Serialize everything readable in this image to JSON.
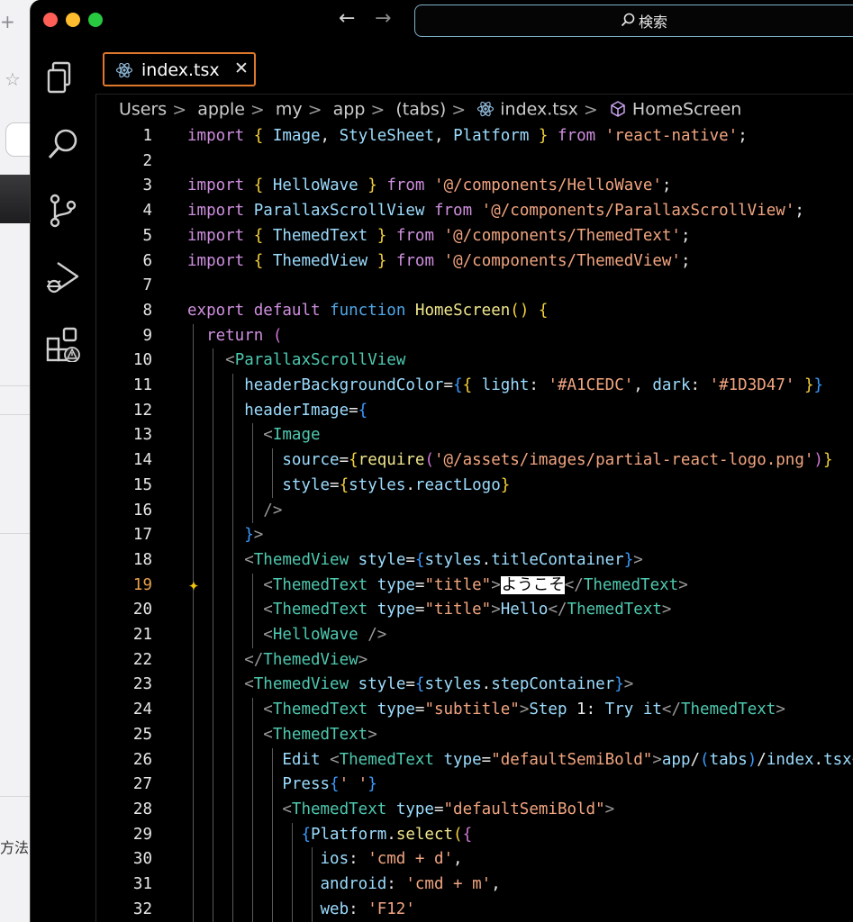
{
  "titlebar": {
    "search_label": "検索"
  },
  "activity_bar": {
    "items": [
      "explorer-icon",
      "search-icon",
      "source-control-icon",
      "run-debug-icon",
      "extensions-icon"
    ]
  },
  "tab": {
    "label": "index.tsx",
    "icon": "react-icon",
    "close": "✕"
  },
  "breadcrumb": [
    "Users",
    "apple",
    "my",
    "app",
    "(tabs)",
    "index.tsx",
    "HomeScreen"
  ],
  "background_window": {
    "text": "方法で"
  },
  "editor": {
    "current_line": 19,
    "lines": [
      "import { Image, StyleSheet, Platform } from 'react-native';",
      "",
      "import { HelloWave } from '@/components/HelloWave';",
      "import ParallaxScrollView from '@/components/ParallaxScrollView';",
      "import { ThemedText } from '@/components/ThemedText';",
      "import { ThemedView } from '@/components/ThemedView';",
      "",
      "export default function HomeScreen() {",
      "  return (",
      "    <ParallaxScrollView",
      "      headerBackgroundColor={{ light: '#A1CEDC', dark: '#1D3D47' }}",
      "      headerImage={",
      "        <Image",
      "          source={require('@/assets/images/partial-react-logo.png')}",
      "          style={styles.reactLogo}",
      "        />",
      "      }>",
      "      <ThemedView style={styles.titleContainer}>",
      "        <ThemedText type=\"title\">ようこそ</ThemedText>",
      "        <ThemedText type=\"title\">Hello</ThemedText>",
      "        <HelloWave />",
      "      </ThemedView>",
      "      <ThemedView style={styles.stepContainer}>",
      "        <ThemedText type=\"subtitle\">Step 1: Try it</ThemedText>",
      "        <ThemedText>",
      "          Edit <ThemedText type=\"defaultSemiBold\">app/(tabs)/index.tsx</ThemedText> to see changes.",
      "          Press{' '}",
      "          <ThemedText type=\"defaultSemiBold\">",
      "            {Platform.select({",
      "              ios: 'cmd + d',",
      "              android: 'cmd + m',",
      "              web: 'F12'"
    ]
  }
}
